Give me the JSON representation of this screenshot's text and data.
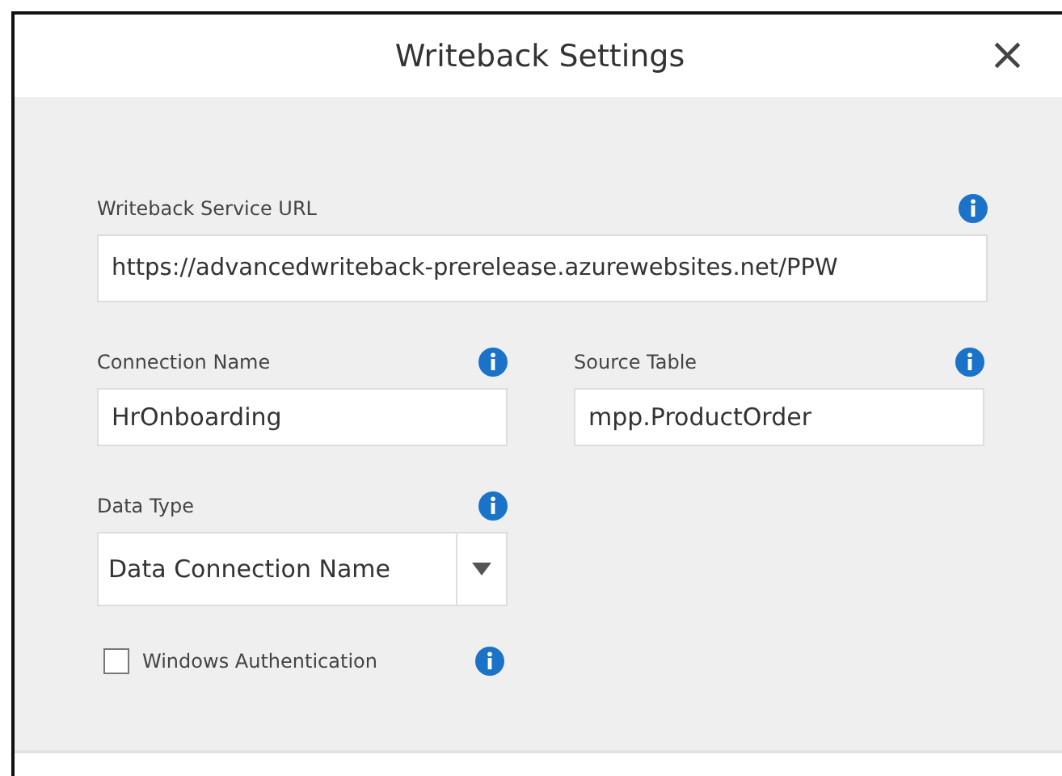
{
  "dialog": {
    "title": "Writeback Settings",
    "close": "×"
  },
  "url_field": {
    "label": "Writeback Service URL",
    "value": "https://advancedwriteback-prerelease.azurewebsites.net/PPW"
  },
  "connection_name": {
    "label": "Connection Name",
    "value": "HrOnboarding"
  },
  "source_table": {
    "label": "Source Table",
    "value": "mpp.ProductOrder"
  },
  "data_type": {
    "label": "Data Type",
    "value": "Data Connection Name"
  },
  "windows_authentication": {
    "label": "Windows Authentication",
    "checked": false
  }
}
